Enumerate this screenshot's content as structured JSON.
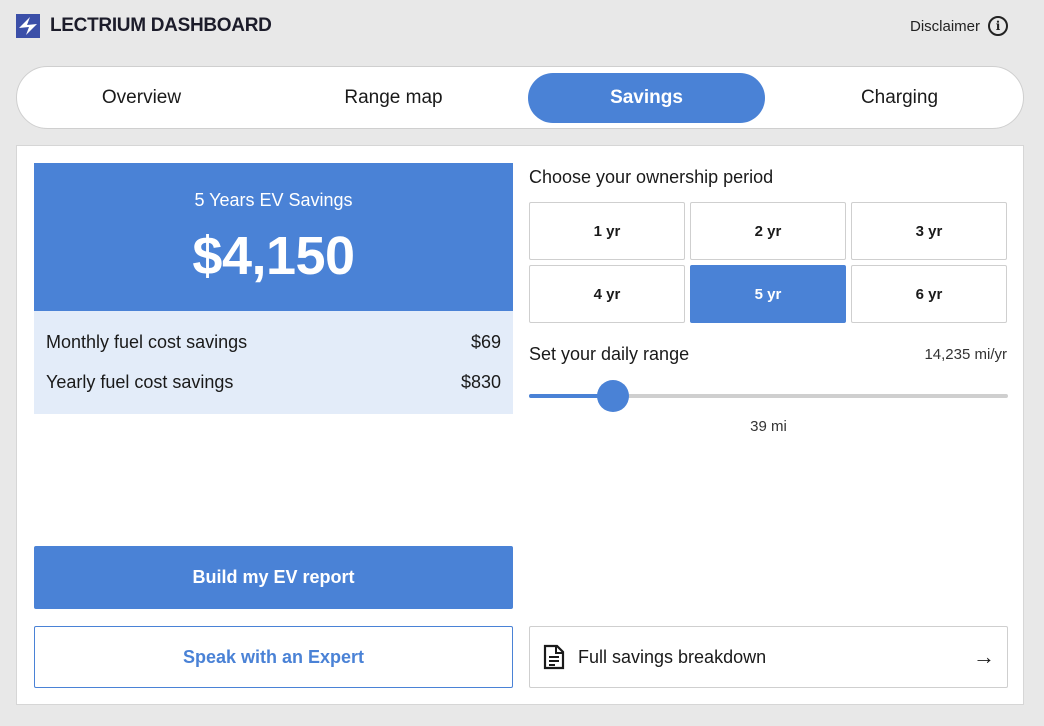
{
  "header": {
    "brand": "LECTRIUM DASHBOARD",
    "logo_icon": "bolt-logo-icon",
    "disclaimer_label": "Disclaimer",
    "info_icon": "info-icon"
  },
  "tabs": [
    {
      "label": "Overview",
      "active": false
    },
    {
      "label": "Range map",
      "active": false
    },
    {
      "label": "Savings",
      "active": true
    },
    {
      "label": "Charging",
      "active": false
    }
  ],
  "savings": {
    "title": "5 Years EV Savings",
    "total": "$4,150",
    "rows": [
      {
        "label": "Monthly fuel cost savings",
        "value": "$69"
      },
      {
        "label": "Yearly fuel cost savings",
        "value": "$830"
      }
    ]
  },
  "actions": {
    "build_report": "Build my EV report",
    "speak_expert": "Speak with an Expert",
    "full_breakdown": "Full savings breakdown"
  },
  "ownership": {
    "label": "Choose your ownership period",
    "options": [
      "1 yr",
      "2 yr",
      "3 yr",
      "4 yr",
      "5 yr",
      "6 yr"
    ],
    "selected": "5 yr"
  },
  "range": {
    "label": "Set your daily range",
    "annual": "14,235 mi/yr",
    "value_label": "39 mi",
    "fill_fraction": 0.175
  },
  "colors": {
    "accent": "#4a82d6",
    "accent_light": "#e3ecf9",
    "background": "#e8e8e8"
  }
}
